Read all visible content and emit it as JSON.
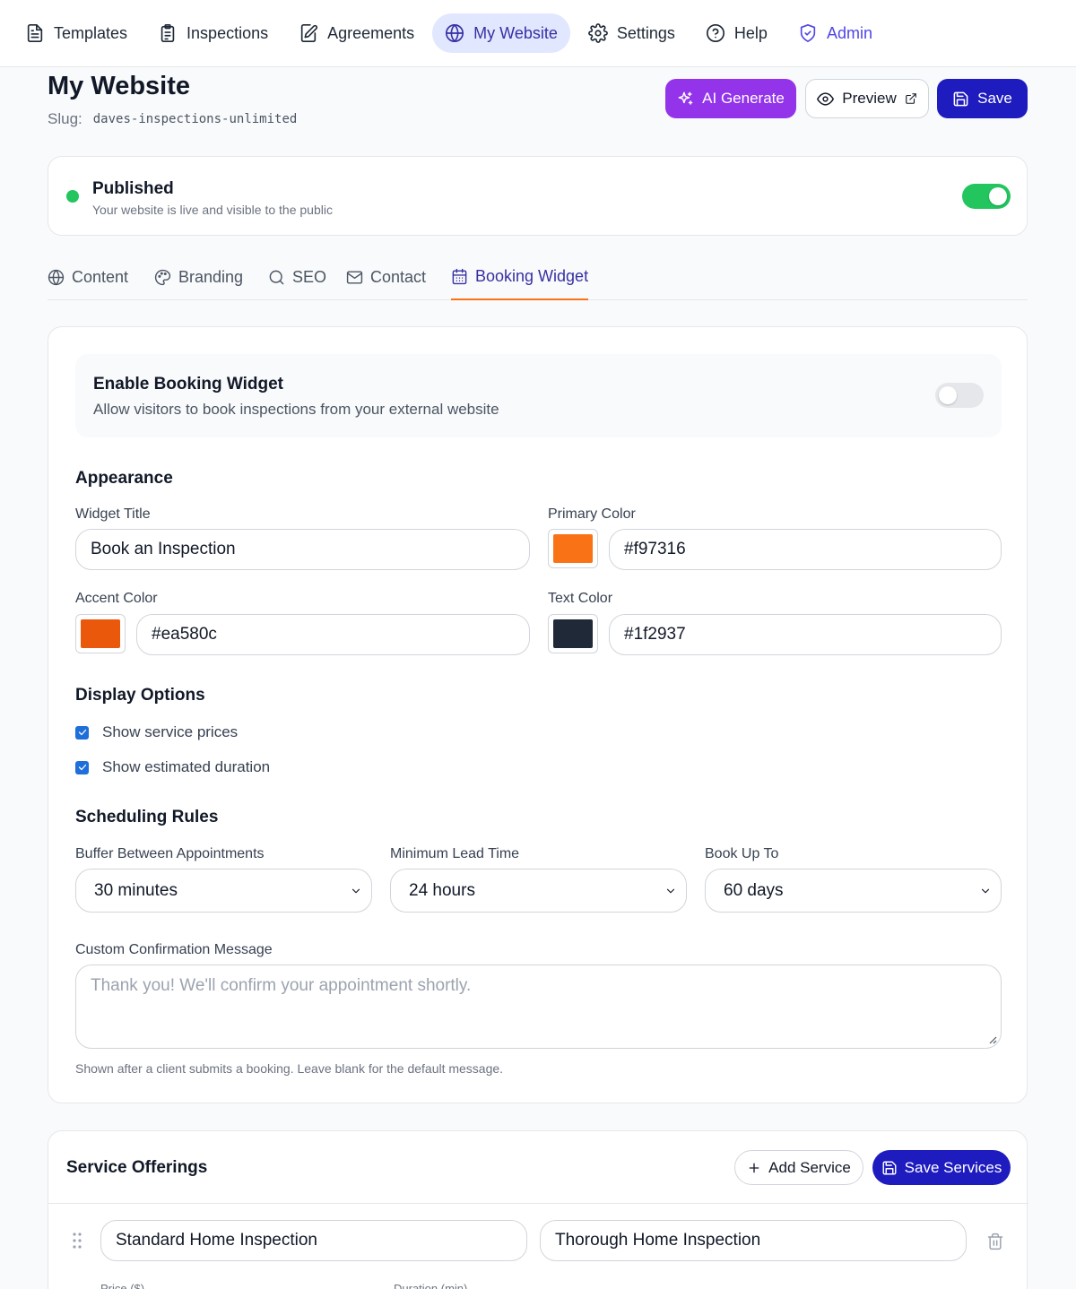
{
  "nav": {
    "items": [
      {
        "label": "Templates",
        "icon": "file-text-icon"
      },
      {
        "label": "Inspections",
        "icon": "clipboard-list-icon"
      },
      {
        "label": "Agreements",
        "icon": "file-signature-icon"
      },
      {
        "label": "My Website",
        "icon": "globe-icon",
        "active": true
      },
      {
        "label": "Settings",
        "icon": "gear-icon"
      },
      {
        "label": "Help",
        "icon": "help-circle-icon"
      },
      {
        "label": "Admin",
        "icon": "shield-check-icon"
      }
    ]
  },
  "header": {
    "title": "My Website",
    "slug_label": "Slug:",
    "slug_value": "daves-inspections-unlimited",
    "ai_label": "AI Generate",
    "preview_label": "Preview",
    "save_label": "Save"
  },
  "status": {
    "title": "Published",
    "subtitle": "Your website is live and visible to the public",
    "enabled": true
  },
  "tabs": [
    {
      "label": "Content",
      "icon": "globe-icon"
    },
    {
      "label": "Branding",
      "icon": "palette-icon"
    },
    {
      "label": "SEO",
      "icon": "search-icon"
    },
    {
      "label": "Contact",
      "icon": "mail-icon"
    },
    {
      "label": "Booking Widget",
      "icon": "calendar-icon",
      "active": true
    }
  ],
  "booking": {
    "enable_title": "Enable Booking Widget",
    "enable_subtitle": "Allow visitors to book inspections from your external website",
    "enabled": false,
    "appearance_title": "Appearance",
    "widget_title_label": "Widget Title",
    "widget_title_value": "Book an Inspection",
    "primary_color_label": "Primary Color",
    "primary_color": "#f97316",
    "accent_color_label": "Accent Color",
    "accent_color": "#ea580c",
    "text_color_label": "Text Color",
    "text_color": "#1f2937",
    "display_title": "Display Options",
    "show_prices_label": "Show service prices",
    "show_duration_label": "Show estimated duration",
    "scheduling_title": "Scheduling Rules",
    "buffer_label": "Buffer Between Appointments",
    "buffer_value": "30 minutes",
    "lead_label": "Minimum Lead Time",
    "lead_value": "24 hours",
    "bookup_label": "Book Up To",
    "bookup_value": "60 days",
    "confirm_label": "Custom Confirmation Message",
    "confirm_placeholder": "Thank you! We'll confirm your appointment shortly.",
    "confirm_helper": "Shown after a client submits a booking. Leave blank for the default message."
  },
  "services": {
    "title": "Service Offerings",
    "add_label": "Add Service",
    "save_label": "Save Services",
    "items": [
      {
        "name": "Standard Home Inspection",
        "description": "Thorough Home Inspection"
      }
    ],
    "price_label": "Price ($)",
    "duration_label": "Duration (min)"
  },
  "colors": {
    "brand": "#1e1bbf",
    "ai": "#9333ea",
    "success": "#22c55e",
    "tab_underline": "#f97316"
  }
}
